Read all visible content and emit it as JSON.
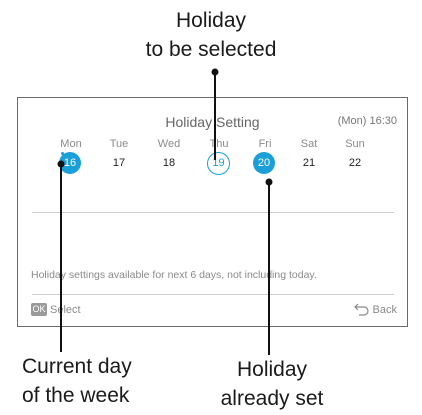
{
  "callouts": {
    "top_line1": "Holiday",
    "top_line2": "to be selected",
    "left_line1": "Current day",
    "left_line2": "of the week",
    "right_line1": "Holiday",
    "right_line2": "already set"
  },
  "screen": {
    "title": "Holiday Setting",
    "clock": "(Mon) 16:30",
    "days": [
      {
        "name": "Mon",
        "date": "16",
        "state": "current"
      },
      {
        "name": "Tue",
        "date": "17",
        "state": "normal"
      },
      {
        "name": "Wed",
        "date": "18",
        "state": "normal"
      },
      {
        "name": "Thu",
        "date": "19",
        "state": "selected"
      },
      {
        "name": "Fri",
        "date": "20",
        "state": "set"
      },
      {
        "name": "Sat",
        "date": "21",
        "state": "normal"
      },
      {
        "name": "Sun",
        "date": "22",
        "state": "normal"
      }
    ],
    "note": "Holiday settings available for next 6 days, not including today.",
    "ok_label": "OK",
    "select_label": "Select",
    "back_label": "Back"
  },
  "colors": {
    "accent": "#1a9fd8",
    "border": "#6a6a6a",
    "muted_text": "#8a8a8a"
  }
}
